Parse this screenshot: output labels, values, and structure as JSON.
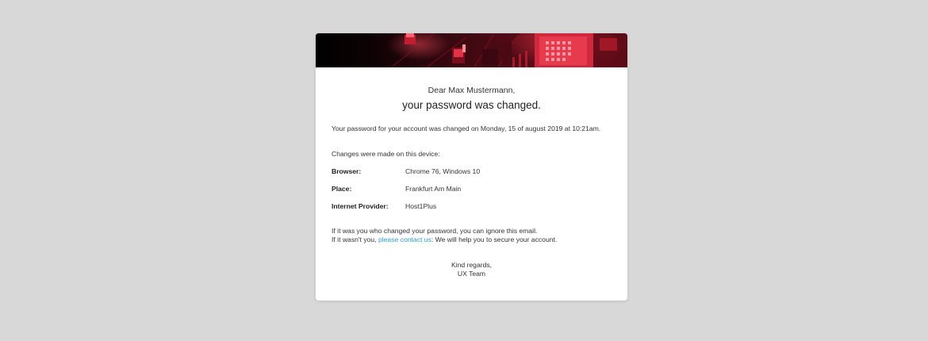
{
  "email": {
    "greeting": "Dear Max Mustermann,",
    "headline": "your password was changed.",
    "intro": "Your password for your account was changed on Monday, 15 of august 2019 at 10:21am.",
    "device_intro": "Changes were made on this device:",
    "details": [
      {
        "label": "Browser:",
        "value": "Chrome 76, Windows 10"
      },
      {
        "label": "Place:",
        "value": "Frankfurt Am Main"
      },
      {
        "label": "Internet Provider:",
        "value": "Host1Plus"
      }
    ],
    "note_line1": "If it was you who changed your password, you can ignore this email.",
    "note_line2_prefix": "If it wasn't you, ",
    "contact_link": "please contact us",
    "note_line2_suffix": ": We will help you to secure your account.",
    "closing": "Kind regards,",
    "signature": "UX Team"
  },
  "colors": {
    "page_background": "#d8d8d8",
    "card_background": "#ffffff",
    "link": "#2a9fd6",
    "banner_accent": "#e0263a"
  },
  "banner": {
    "image": "red circuit board banner"
  }
}
